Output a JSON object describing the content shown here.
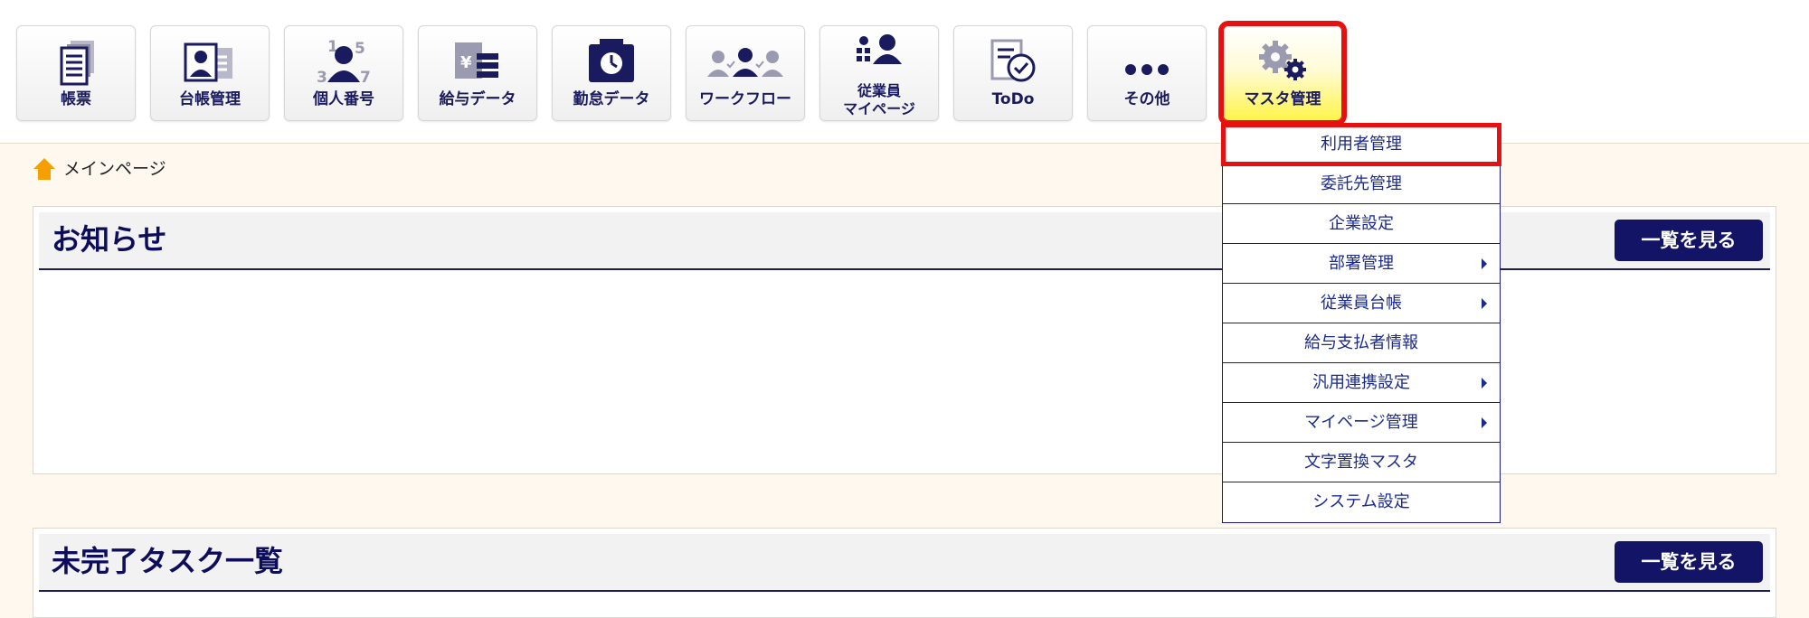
{
  "nav": {
    "items": [
      {
        "label": "帳票",
        "icon": "document-icon"
      },
      {
        "label": "台帳管理",
        "icon": "id-card-icon"
      },
      {
        "label": "個人番号",
        "icon": "person-number-icon"
      },
      {
        "label": "給与データ",
        "icon": "salary-data-icon"
      },
      {
        "label": "勤怠データ",
        "icon": "timecard-icon"
      },
      {
        "label": "ワークフロー",
        "icon": "workflow-icon"
      },
      {
        "label_line1": "従業員",
        "label_line2": "マイページ",
        "icon": "employee-mypage-icon"
      },
      {
        "label": "ToDo",
        "icon": "todo-check-icon"
      },
      {
        "label": "その他",
        "icon": "more-dots-icon"
      },
      {
        "label": "マスタ管理",
        "icon": "gears-icon",
        "active": true
      }
    ]
  },
  "breadcrumb": {
    "label": "メインページ",
    "icon": "home-icon"
  },
  "notices": {
    "title": "お知らせ",
    "button": "一覧を見る"
  },
  "tasks": {
    "title": "未完了タスク一覧",
    "button": "一覧を見る"
  },
  "dropdown": {
    "items": [
      {
        "label": "利用者管理",
        "submenu": false,
        "highlighted": true
      },
      {
        "label": "委託先管理",
        "submenu": false
      },
      {
        "label": "企業設定",
        "submenu": false
      },
      {
        "label": "部署管理",
        "submenu": true
      },
      {
        "label": "従業員台帳",
        "submenu": true
      },
      {
        "label": "給与支払者情報",
        "submenu": false
      },
      {
        "label": "汎用連携設定",
        "submenu": true
      },
      {
        "label": "マイページ管理",
        "submenu": true
      },
      {
        "label": "文字置換マスタ",
        "submenu": false
      },
      {
        "label": "システム設定",
        "submenu": false
      }
    ]
  },
  "colors": {
    "navy": "#1a1a5e",
    "active_outline": "#e61010",
    "active_fill": "#fff44a",
    "page_bg": "#fff8ef"
  }
}
